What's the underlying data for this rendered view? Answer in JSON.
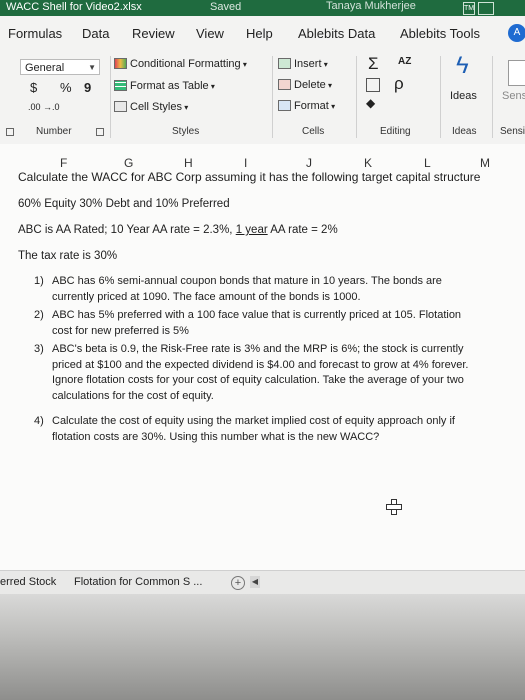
{
  "titlebar": {
    "file_title": "WACC Shell for Video2.xlsx",
    "saved": "Saved",
    "user": "Tanaya Mukherjee",
    "user_initials": "TM"
  },
  "ribbon": {
    "tabs": [
      "Formulas",
      "Data",
      "Review",
      "View",
      "Help",
      "Ablebits Data",
      "Ablebits Tools"
    ],
    "account_initial": "A",
    "number": {
      "format_value": "General",
      "currency": "$",
      "percent": "%",
      "comma": "9",
      "decimal_buttons": ".00 →.0",
      "group_label": "Number"
    },
    "styles": {
      "conditional": "Conditional Formatting",
      "format_table": "Format as Table",
      "cell_styles": "Cell Styles",
      "group_label": "Styles"
    },
    "cells": {
      "insert": "Insert",
      "delete": "Delete",
      "format": "Format",
      "group_label": "Cells"
    },
    "editing": {
      "sum": "Σ",
      "sort": "AZ",
      "find": "ρ",
      "group_label": "Editing"
    },
    "ideas": {
      "label": "Ideas",
      "group_label": "Ideas"
    },
    "sensitivity": {
      "label": "Sens",
      "group_label": "Sensi"
    }
  },
  "sheet": {
    "columns": [
      "F",
      "G",
      "H",
      "I",
      "J",
      "K",
      "L",
      "M"
    ],
    "title": "Calculate the WACC for ABC Corp assuming it has the following target capital structure",
    "structure": "60% Equity 30% Debt and 10% Preferred",
    "rates_a": "ABC is AA Rated; 10 Year AA rate = 2.3%,",
    "rates_b": "1 year",
    "rates_c": "AA rate = 2%",
    "tax": "The tax rate is 30%",
    "items": [
      {
        "num": "1)",
        "text": "ABC has 6% semi-annual coupon bonds that mature in 10 years.  The bonds are currently priced at 1090.  The face amount of the bonds is 1000."
      },
      {
        "num": "2)",
        "text": "ABC has 5% preferred with a 100 face value that is currently priced at 105. Flotation cost for new preferred is 5%"
      },
      {
        "num": "3)",
        "text": "ABC's beta is 0.9, the Risk-Free rate is 3% and the MRP is 6%; the stock is currently priced at $100 and the expected dividend is $4.00 and forecast to grow at 4% forever.  Ignore flotation costs for your cost of equity calculation.  Take the average of your two calculations for the cost of equity."
      },
      {
        "num": "4)",
        "text": "Calculate the cost of equity using the market implied cost of equity approach only if flotation costs are 30%.  Using this number what is the new WACC?"
      }
    ]
  },
  "sheet_tabs": {
    "tab1": "erred Stock",
    "tab2": "Flotation for Common S ...",
    "add": "+"
  }
}
